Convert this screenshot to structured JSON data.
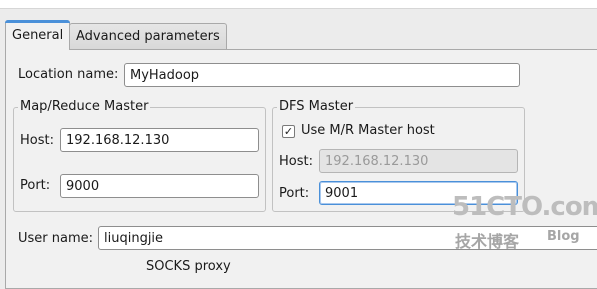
{
  "tabs": [
    {
      "label": "General",
      "active": true
    },
    {
      "label": "Advanced parameters",
      "active": false
    }
  ],
  "location": {
    "label": "Location name:",
    "value": "MyHadoop"
  },
  "mapreduce": {
    "title": "Map/Reduce Master",
    "host_label": "Host:",
    "host_value": "192.168.12.130",
    "port_label": "Port:",
    "port_value": "9000"
  },
  "dfs": {
    "title": "DFS Master",
    "use_mr_label": "Use M/R Master host",
    "use_mr_checked": true,
    "host_label": "Host:",
    "host_value": "192.168.12.130",
    "port_label": "Port:",
    "port_value": "9001"
  },
  "user": {
    "label": "User name:",
    "value": "liuqingjie"
  },
  "socks": {
    "title": "SOCKS proxy"
  },
  "watermark": {
    "main": "51CTO.com",
    "sub": "技术博客",
    "blog": "Blog"
  },
  "colors": {
    "accent": "#4a90d9",
    "panel": "#f1f1f1",
    "background": "#ececec"
  }
}
